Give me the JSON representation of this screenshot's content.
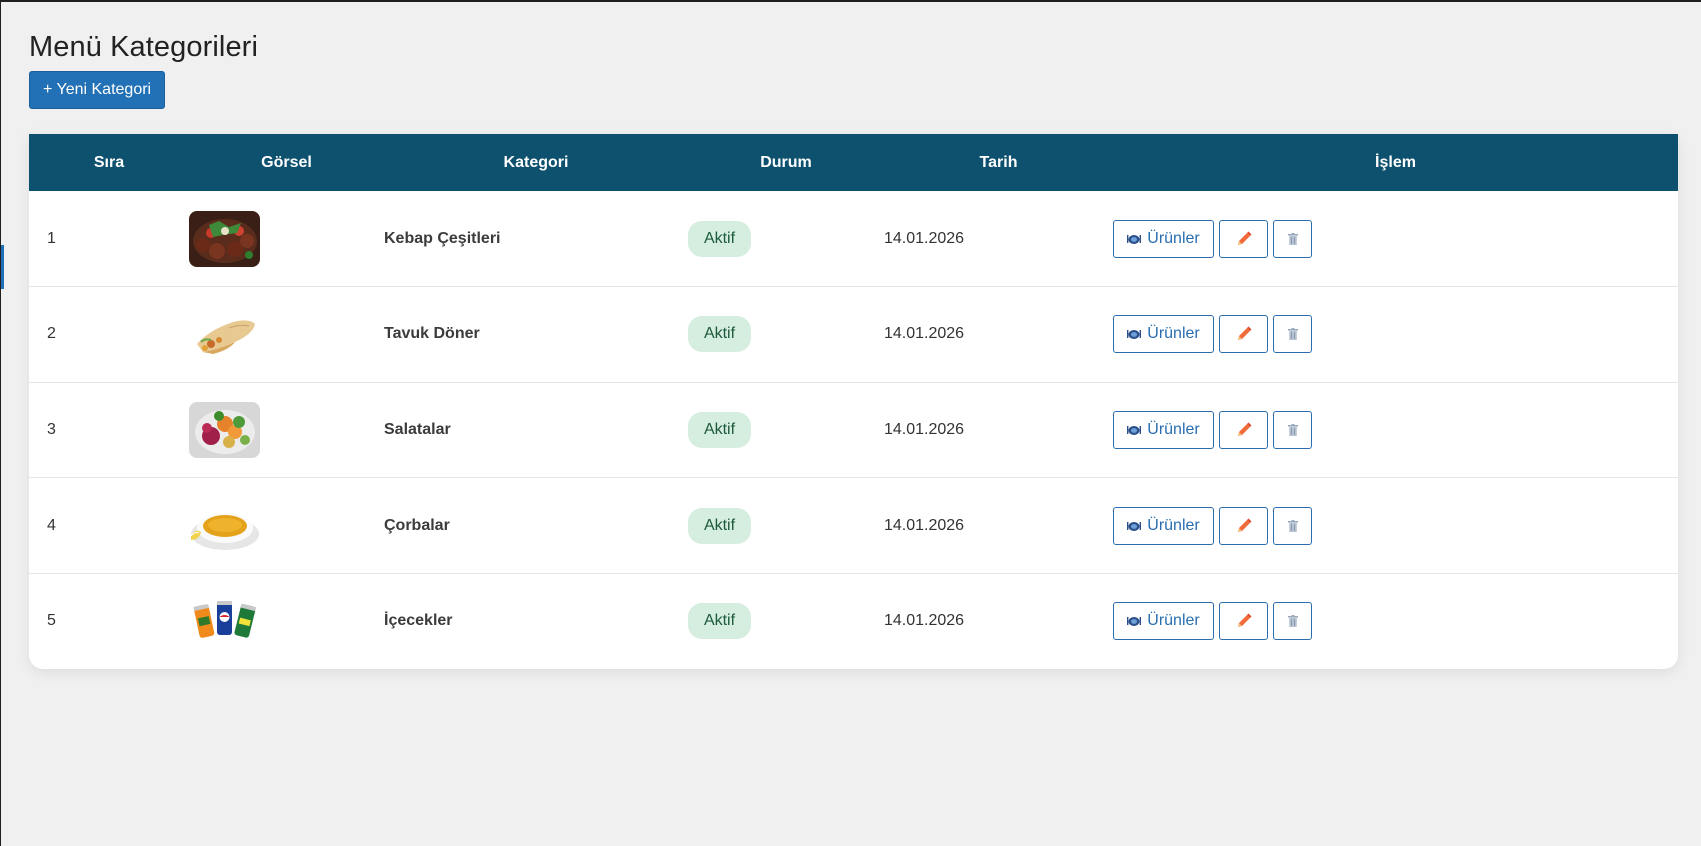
{
  "page": {
    "title": "Menü Kategorileri",
    "new_button_label": "+ Yeni Kategori"
  },
  "table": {
    "headers": [
      "Sıra",
      "Görsel",
      "Kategori",
      "Durum",
      "Tarih",
      "İşlem"
    ],
    "rows": [
      {
        "no": "1",
        "image": "kebab-platter-photo",
        "category": "Kebap Çeşitleri",
        "status": "Aktif",
        "date": "14.01.2026"
      },
      {
        "no": "2",
        "image": "chicken-wrap-photo",
        "category": "Tavuk Döner",
        "status": "Aktif",
        "date": "14.01.2026"
      },
      {
        "no": "3",
        "image": "salad-bowl-photo",
        "category": "Salatalar",
        "status": "Aktif",
        "date": "14.01.2026"
      },
      {
        "no": "4",
        "image": "lentil-soup-photo",
        "category": "Çorbalar",
        "status": "Aktif",
        "date": "14.01.2026"
      },
      {
        "no": "5",
        "image": "soda-cans-photo",
        "category": "İçecekler",
        "status": "Aktif",
        "date": "14.01.2026"
      }
    ],
    "actions": {
      "products_label": "Ürünler",
      "products_icon": "plate-icon",
      "edit_icon": "pencil-icon",
      "delete_icon": "trash-icon"
    }
  },
  "colors": {
    "page_background": "#f0f0f0",
    "header_background": "#0e516f",
    "primary_button": "#2270b5",
    "badge_background": "#d5eee0",
    "badge_text": "#1d5a3a",
    "edit_icon": "#f06a3a"
  }
}
